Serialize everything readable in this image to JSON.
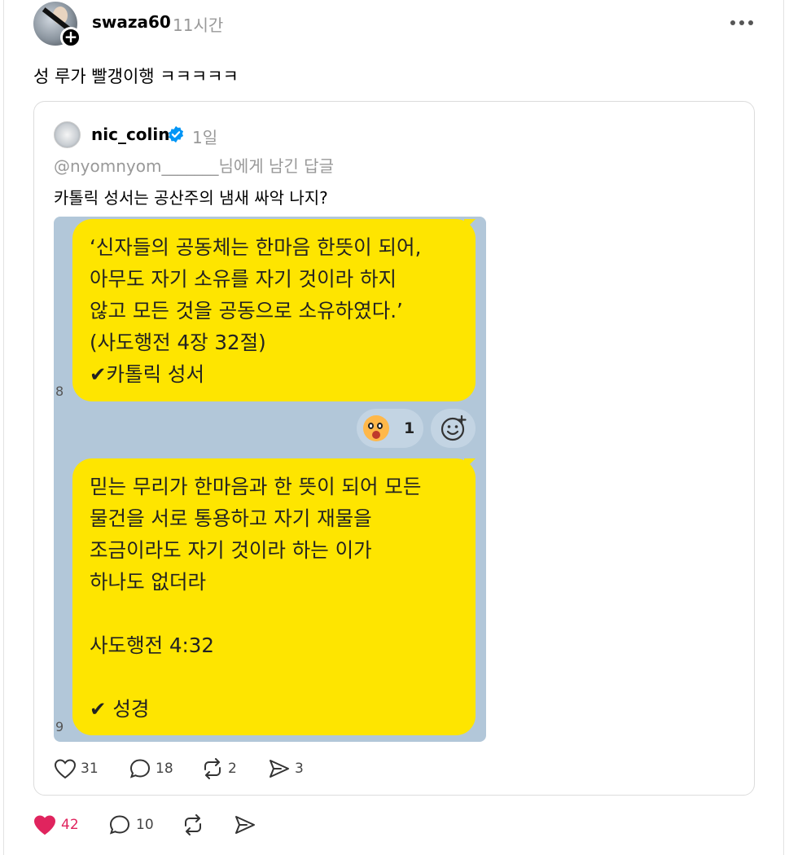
{
  "post": {
    "username": "swaza60",
    "time": "11시간",
    "text": "성 루가 빨갱이행 ㅋㅋㅋㅋㅋ",
    "follow_badge": "+",
    "likes": "42",
    "replies": "10",
    "liked": true,
    "like_color": "#e0245e"
  },
  "quote": {
    "username": "nic_colin",
    "time": "1일",
    "reply_to": "@nyomnyom_______님에게 남긴 답글",
    "text": "카톨릭 성서는 공산주의 냄새 싸악 나지?",
    "likes": "31",
    "replies": "18",
    "reposts": "2",
    "shares": "3",
    "verified_color": "#0095f6"
  },
  "chat": {
    "bubble1": "‘신자들의 공동체는 한마음 한뜻이 되어,\n아무도 자기 소유를 자기 것이라 하지\n않고 모든 것을 공동으로 소유하였다.’\n(사도행전 4장 32절)\n✔카톨릭 성서",
    "bubble2": "믿는 무리가 한마음과 한 뜻이 되어 모든\n물건을 서로 통용하고 자기 재물을\n조금이라도 자기 것이라 하는 이가\n하나도 없더라\n\n사도행전 4:32\n\n✔ 성경",
    "num1": "8",
    "num2": "9",
    "reaction_count": "1",
    "bubble_color": "#fee500",
    "background_color": "#b2c7d9"
  }
}
